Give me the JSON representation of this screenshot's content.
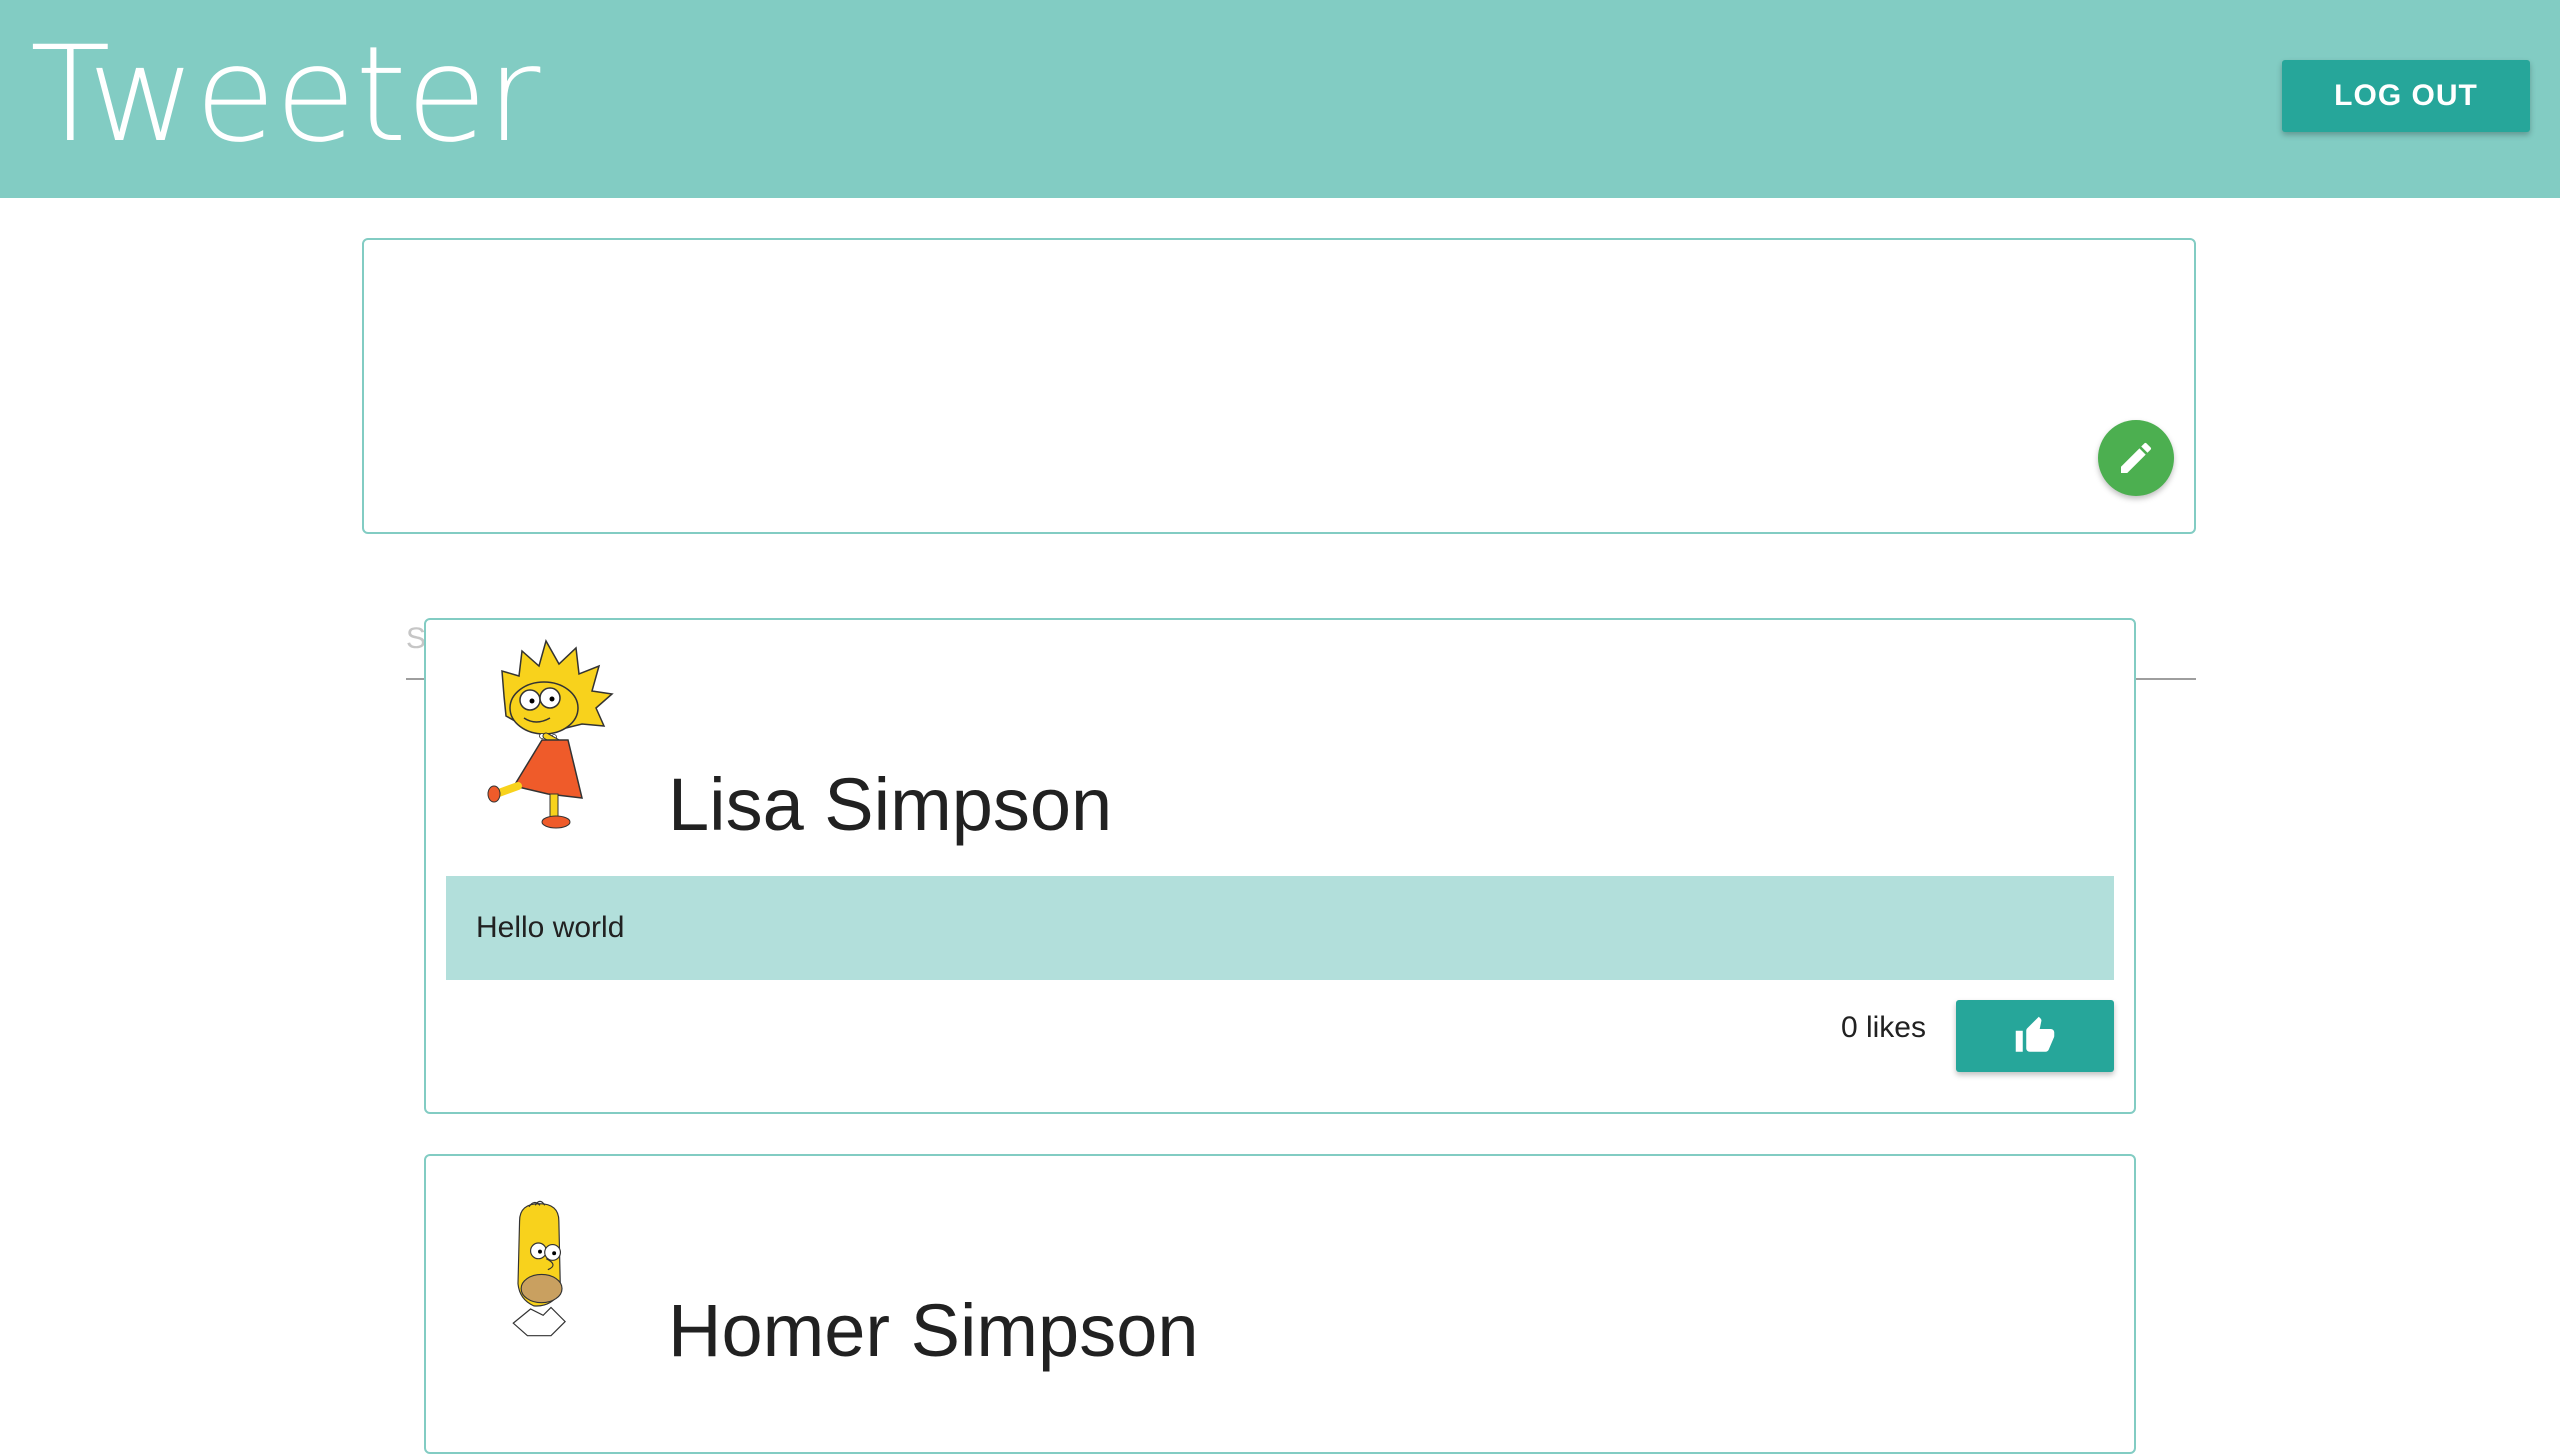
{
  "header": {
    "title": "Tweeter",
    "logout_label": "LOG OUT",
    "background": "#82ccc3"
  },
  "composer": {
    "placeholder": "Start typing...",
    "value": "",
    "submit_icon": "pencil-icon",
    "submit_color": "#4caf50"
  },
  "tweets": [
    {
      "author": "Lisa Simpson",
      "avatar": "lisa-simpson-avatar",
      "body": "Hello world",
      "likes_label": "0 likes",
      "like_icon": "thumbs-up-icon"
    },
    {
      "author": "Homer Simpson",
      "avatar": "homer-simpson-avatar"
    }
  ],
  "colors": {
    "accent": "#26a69a",
    "card_border": "#82ccc3",
    "tweet_body_bg": "#b2dfdb"
  }
}
